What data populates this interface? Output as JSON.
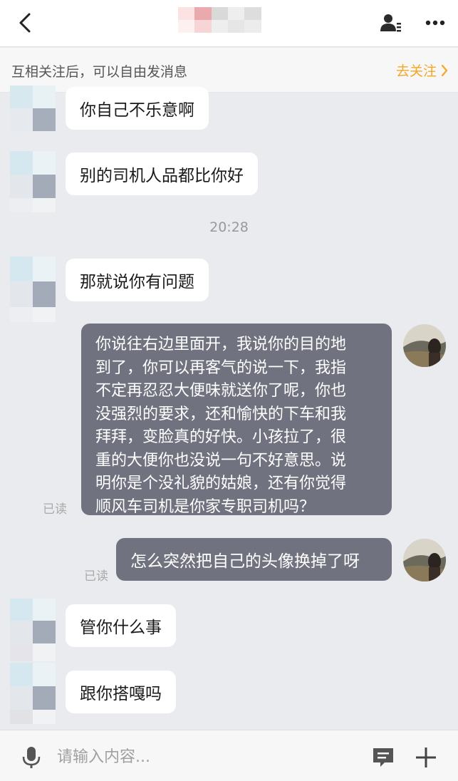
{
  "header": {
    "back_icon": "chevron-left-icon",
    "profile_icon": "user-profile-icon",
    "more_icon": "more-dots-icon"
  },
  "follow_bar": {
    "text": "互相关注后，可以自由发消息",
    "action_label": "去关注",
    "action_color": "#f5a623"
  },
  "messages": [
    {
      "side": "left",
      "text": "你自己不乐意啊"
    },
    {
      "side": "left",
      "text": "别的司机人品都比你好"
    },
    {
      "timestamp": "20:28"
    },
    {
      "side": "left",
      "text": "那就说你有问题"
    },
    {
      "side": "right",
      "lines": [
        "你说往右边里面开，我说你的目的地",
        "到了，你可以再客气的说一下，我指",
        "不定再忍忍大便味就送你了呢，你也",
        "没强烈的要求，还和愉快的下车和我",
        "拜拜，变脸真的好快。小孩拉了，很",
        "重的大便你也没说一句不好意思。说",
        "明你是个没礼貌的姑娘，还有你觉得",
        "顺风车司机是你家专职司机吗？"
      ],
      "status": "已读"
    },
    {
      "side": "right",
      "text": "怎么突然把自己的头像换掉了呀",
      "status": "已读"
    },
    {
      "side": "left",
      "text": "管你什么事"
    },
    {
      "side": "left",
      "text": "跟你搭嘎吗"
    }
  ],
  "input_bar": {
    "placeholder": "请输入内容...",
    "mic_icon": "microphone-icon",
    "quick_reply_icon": "message-square-icon",
    "add_icon": "plus-icon"
  },
  "colors": {
    "background": "#e9ebee",
    "outgoing_bubble": "#71727f",
    "incoming_bubble": "#ffffff"
  }
}
